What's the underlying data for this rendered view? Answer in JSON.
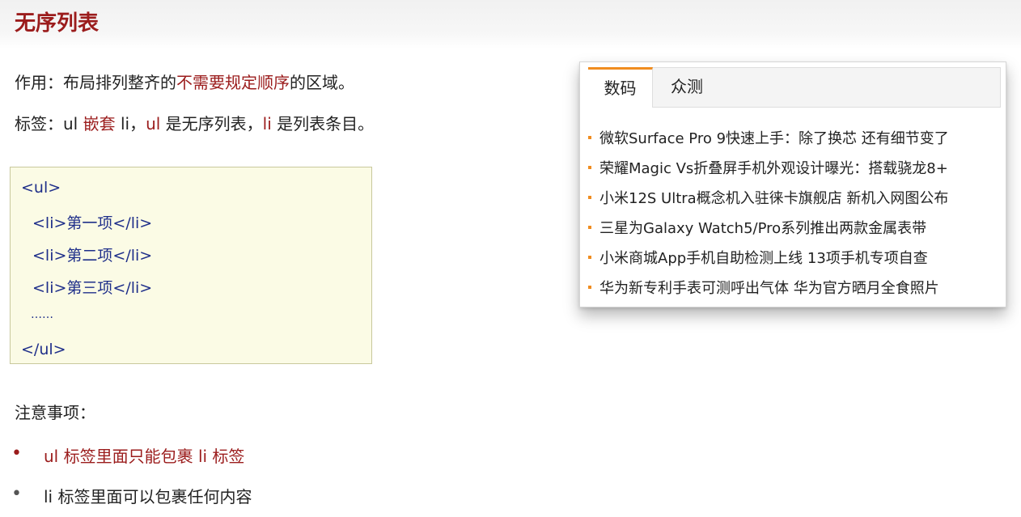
{
  "slide": {
    "title": "无序列表",
    "purpose": {
      "prefix": "作用：布局排列整齐的",
      "highlight": "不需要规定顺序",
      "suffix": "的区域。"
    },
    "tags": {
      "prefix": "标签：ul ",
      "nest": "嵌套",
      "mid1": " li，",
      "ul": "ul",
      "mid2": " 是无序列表，",
      "li": "li",
      "suffix": " 是列表条目。"
    },
    "code_lines": [
      "<ul>",
      "<li>第一项</li>",
      "<li>第二项</li>",
      "<li>第三项</li>",
      "……",
      "</ul>"
    ],
    "notes_heading": "注意事项：",
    "notes": [
      "ul 标签里面只能包裹 li 标签",
      "li 标签里面可以包裹任何内容"
    ],
    "bullet_char": "•"
  },
  "widget": {
    "tabs": [
      {
        "label": "数码",
        "active": true
      },
      {
        "label": "众测",
        "active": false
      }
    ],
    "news": [
      "微软Surface Pro 9快速上手：除了换芯 还有细节变了",
      "荣耀Magic Vs折叠屏手机外观设计曝光：搭载骁龙8+",
      "小米12S Ultra概念机入驻徕卡旗舰店 新机入网图公布",
      "三星为Galaxy Watch5/Pro系列推出两款金属表带",
      "小米商城App手机自助检测上线 13项手机专项自查",
      "华为新专利手表可测呼出气体 华为官方晒月全食照片"
    ]
  },
  "colors": {
    "accent_red": "#9b1c1c",
    "code_blue": "#1f2f8a",
    "tab_orange": "#f08c1f",
    "code_bg": "#fbfbe5"
  }
}
